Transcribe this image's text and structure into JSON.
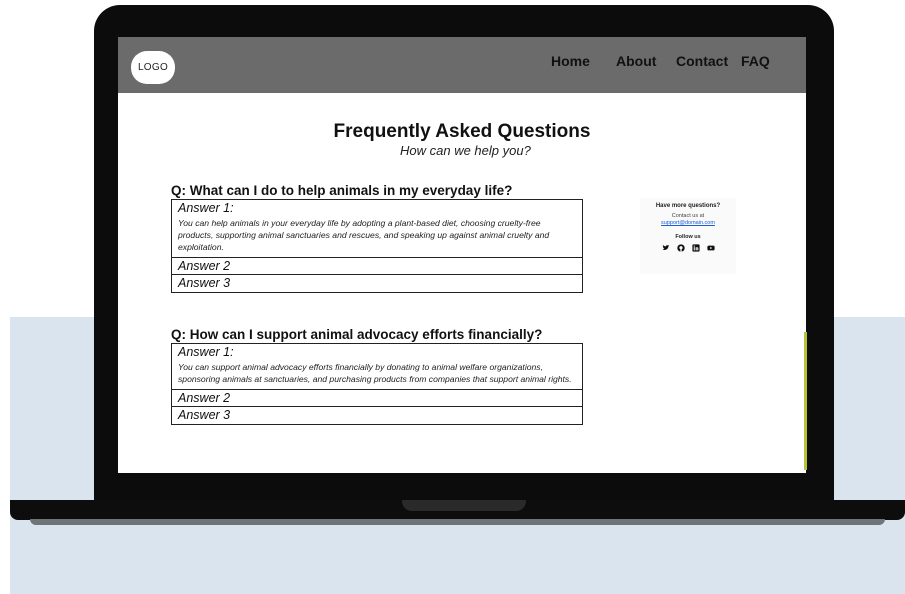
{
  "nav": {
    "logo": "LOGO",
    "links": [
      "Home",
      "About",
      "Contact",
      "FAQ"
    ]
  },
  "page": {
    "title": "Frequently Asked Questions",
    "subtitle": "How can we help you?"
  },
  "faqs": [
    {
      "question": "Q: What can I do to help animals in my everyday life?",
      "answer1_title": "Answer 1:",
      "answer1_text": "You can help animals in your everyday life by adopting a plant-based diet, choosing cruelty-free products, supporting animal sanctuaries and rescues, and speaking up against animal cruelty and exploitation.",
      "answer2": "Answer 2",
      "answer3": "Answer 3"
    },
    {
      "question": "Q: How can I support animal advocacy efforts financially?",
      "answer1_title": "Answer 1:",
      "answer1_text": "You can support animal advocacy efforts financially by donating to animal welfare organizations, sponsoring animals at sanctuaries, and purchasing products from companies that support animal rights.",
      "answer2": "Answer 2",
      "answer3": "Answer 3"
    }
  ],
  "sidebar": {
    "heading": "Have more questions?",
    "contact_text": "Contact us at",
    "email": "support@domain.com",
    "follow_label": "Follow us",
    "social_icons": [
      "twitter-icon",
      "github-icon",
      "linkedin-icon",
      "youtube-icon"
    ]
  }
}
